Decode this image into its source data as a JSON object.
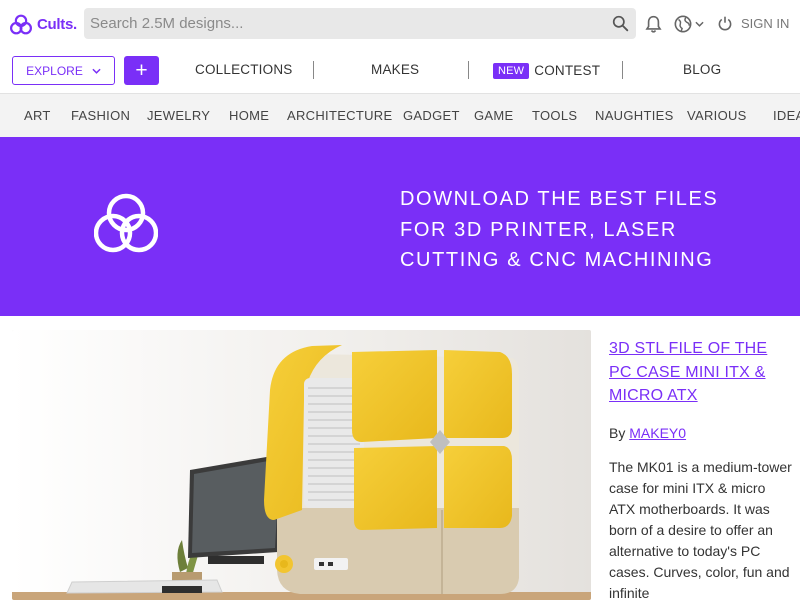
{
  "header": {
    "logo_text": "Cults.",
    "search_placeholder": "Search 2.5M designs...",
    "signin_label": "SIGN IN",
    "icons": [
      "cults-logo-icon",
      "search-icon",
      "bell-icon",
      "globe-icon",
      "chevron-down-icon",
      "power-icon"
    ]
  },
  "nav": {
    "explore_label": "EXPLORE",
    "add_label": "+",
    "links": [
      "COLLECTIONS",
      "MAKES",
      "CONTEST",
      "BLOG"
    ],
    "new_badge": "NEW"
  },
  "categories": [
    "ART",
    "FASHION",
    "JEWELRY",
    "HOME",
    "ARCHITECTURE",
    "GADGET",
    "GAME",
    "TOOLS",
    "NAUGHTIES",
    "VARIOUS",
    "IDEAS"
  ],
  "banner": {
    "lines": [
      "DOWNLOAD THE BEST FILES",
      "FOR 3D PRINTER, LASER",
      "CUTTING & CNC MACHINING"
    ]
  },
  "featured": {
    "title": "3D STL FILE OF THE PC CASE MINI ITX & MICRO ATX",
    "by_label": "By",
    "author": "MAKEY0",
    "description": "The MK01 is a medium-tower case for mini ITX & micro ATX motherboards. It was born of a desire to offer an alternative to today's PC cases. Curves, color, fun and infinite"
  },
  "colors": {
    "brand": "#7a2ff7",
    "category_bar": "#f3f3f3",
    "search_bg": "#e8e8e8"
  }
}
